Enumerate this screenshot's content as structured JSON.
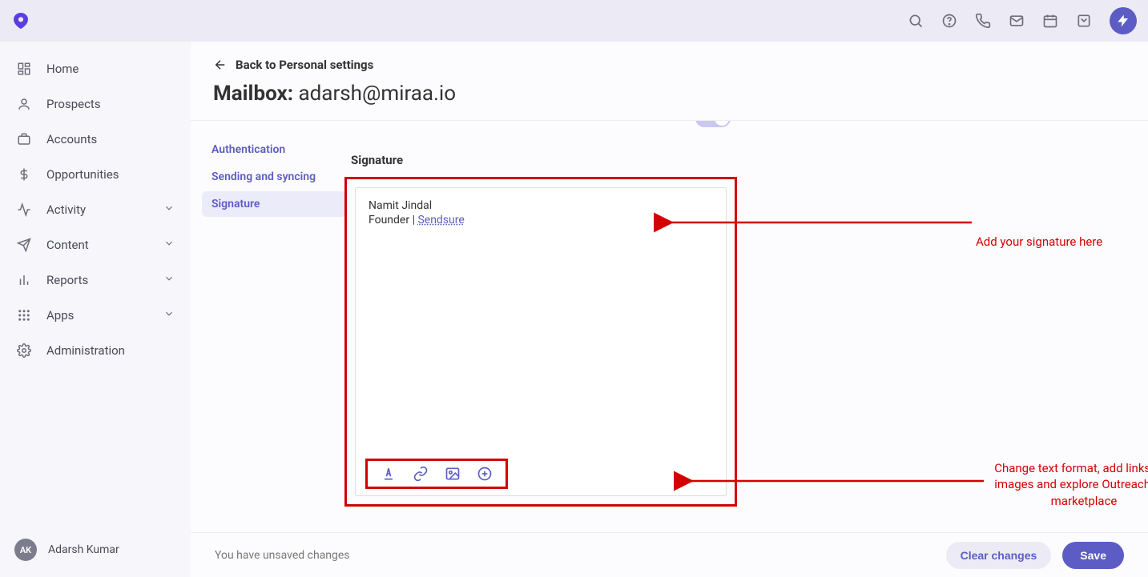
{
  "topbar": {
    "icons": [
      "search",
      "help",
      "phone",
      "mail",
      "calendar",
      "note"
    ],
    "avatar_glyph": "⚡"
  },
  "sidebar": {
    "items": [
      {
        "label": "Home",
        "icon": "dashboard"
      },
      {
        "label": "Prospects",
        "icon": "person"
      },
      {
        "label": "Accounts",
        "icon": "briefcase"
      },
      {
        "label": "Opportunities",
        "icon": "dollar"
      },
      {
        "label": "Activity",
        "icon": "send",
        "expandable": true
      },
      {
        "label": "Content",
        "icon": "plane",
        "expandable": true
      },
      {
        "label": "Reports",
        "icon": "bars",
        "expandable": true
      },
      {
        "label": "Apps",
        "icon": "grid",
        "expandable": true
      },
      {
        "label": "Administration",
        "icon": "gear"
      }
    ],
    "user": {
      "initials": "AK",
      "name": "Adarsh Kumar"
    }
  },
  "header": {
    "back_label": "Back to Personal settings",
    "title_prefix": "Mailbox:",
    "email": "adarsh@miraa.io"
  },
  "sub_nav": {
    "items": [
      {
        "label": "Authentication",
        "active": false
      },
      {
        "label": "Sending and syncing",
        "active": false
      },
      {
        "label": "Signature",
        "active": true
      }
    ]
  },
  "signature_section": {
    "heading": "Signature",
    "line1": "Namit Jindal",
    "line2_prefix": "Founder | ",
    "line2_link": "Sendsure",
    "toolbar": [
      "text-format",
      "link",
      "image",
      "add"
    ]
  },
  "annotations": {
    "a1": "Add your signature here",
    "a2": "Change text format, add links and images and explore Outreach app marketplace"
  },
  "footer": {
    "unsaved_msg": "You have unsaved changes",
    "clear_label": "Clear changes",
    "save_label": "Save"
  }
}
